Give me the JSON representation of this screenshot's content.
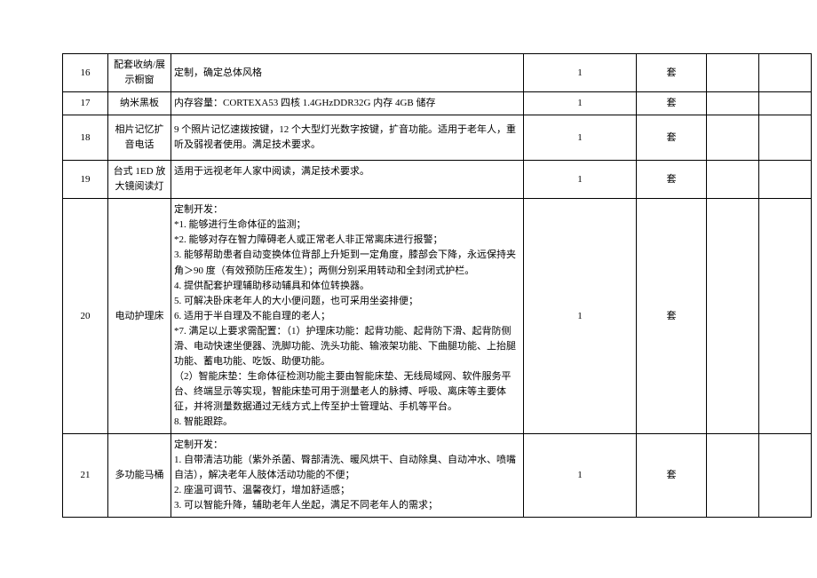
{
  "rows": [
    {
      "num": "16",
      "name": "配套收纳/展示橱窗",
      "desc": "定制，确定总体风格",
      "qty": "1",
      "unit": "套"
    },
    {
      "num": "17",
      "name": "纳米黑板",
      "desc": "内存容量：CORTEXA53 四核 1.4GHzDDR32G 内存 4GB 储存",
      "qty": "1",
      "unit": "套"
    },
    {
      "num": "18",
      "name": "相片记忆扩音电话",
      "desc": "9 个照片记忆速拨按键，12 个大型灯光数字按键，扩音功能。适用于老年人，重听及弱视者使用。满足技术要求。",
      "qty": "1",
      "unit": "套"
    },
    {
      "num": "19",
      "name": "台式 1ED 放大镜阅读灯",
      "desc": "适用于远视老年人家中阅读，满足技术要求。",
      "qty": "1",
      "unit": "套"
    },
    {
      "num": "20",
      "name": "电动护理床",
      "desc_lines": [
        "定制开发：",
        "*1. 能够进行生命体征的监测；",
        "*2. 能够对存在智力障碍老人或正常老人非正常离床进行报警；",
        "3. 能够帮助患者自动变换体位背部上升矩到一定角度，膝部会下降，永远保持夹角＞90 度（有效预防压疮发生）；两侧分别采用转动和全封闭式护栏。",
        "4. 提供配套护理辅助移动辅具和体位转换器。",
        "5. 可解决卧床老年人的大小便问题，也可采用坐姿排便；",
        "6. 适用于半自理及不能自理的老人；",
        "*7. 满足以上要求需配置：（1）护理床功能：起背功能、起背防下滑、起背防侧滑、电动快速坐便器、洗脚功能、洗头功能、输液架功能、下曲腿功能、上抬腿功能、蓄电功能、吃饭、助便功能。",
        "（2）智能床垫：生命体征检测功能主要由智能床垫、无线局域网、软件服务平台、终端显示等实现，智能床垫可用于测量老人的脉搏、呼吸、离床等主要体征，并将测量数据通过无线方式上传至护士管理站、手机等平台。",
        "8. 智能跟踪。"
      ],
      "qty": "1",
      "unit": "套"
    },
    {
      "num": "21",
      "name": "多功能马桶",
      "desc_lines": [
        "定制开发：",
        "1. 自带清洁功能（紫外杀菌、臀部清洗、暖风烘干、自动除臭、自动冲水、喷嘴自洁），解决老年人肢体活动功能的不便；",
        "2. 座温可调节、温馨夜灯，增加舒适感；",
        "3. 可以智能升降，辅助老年人坐起，满足不同老年人的需求；"
      ],
      "qty": "1",
      "unit": "套"
    }
  ]
}
